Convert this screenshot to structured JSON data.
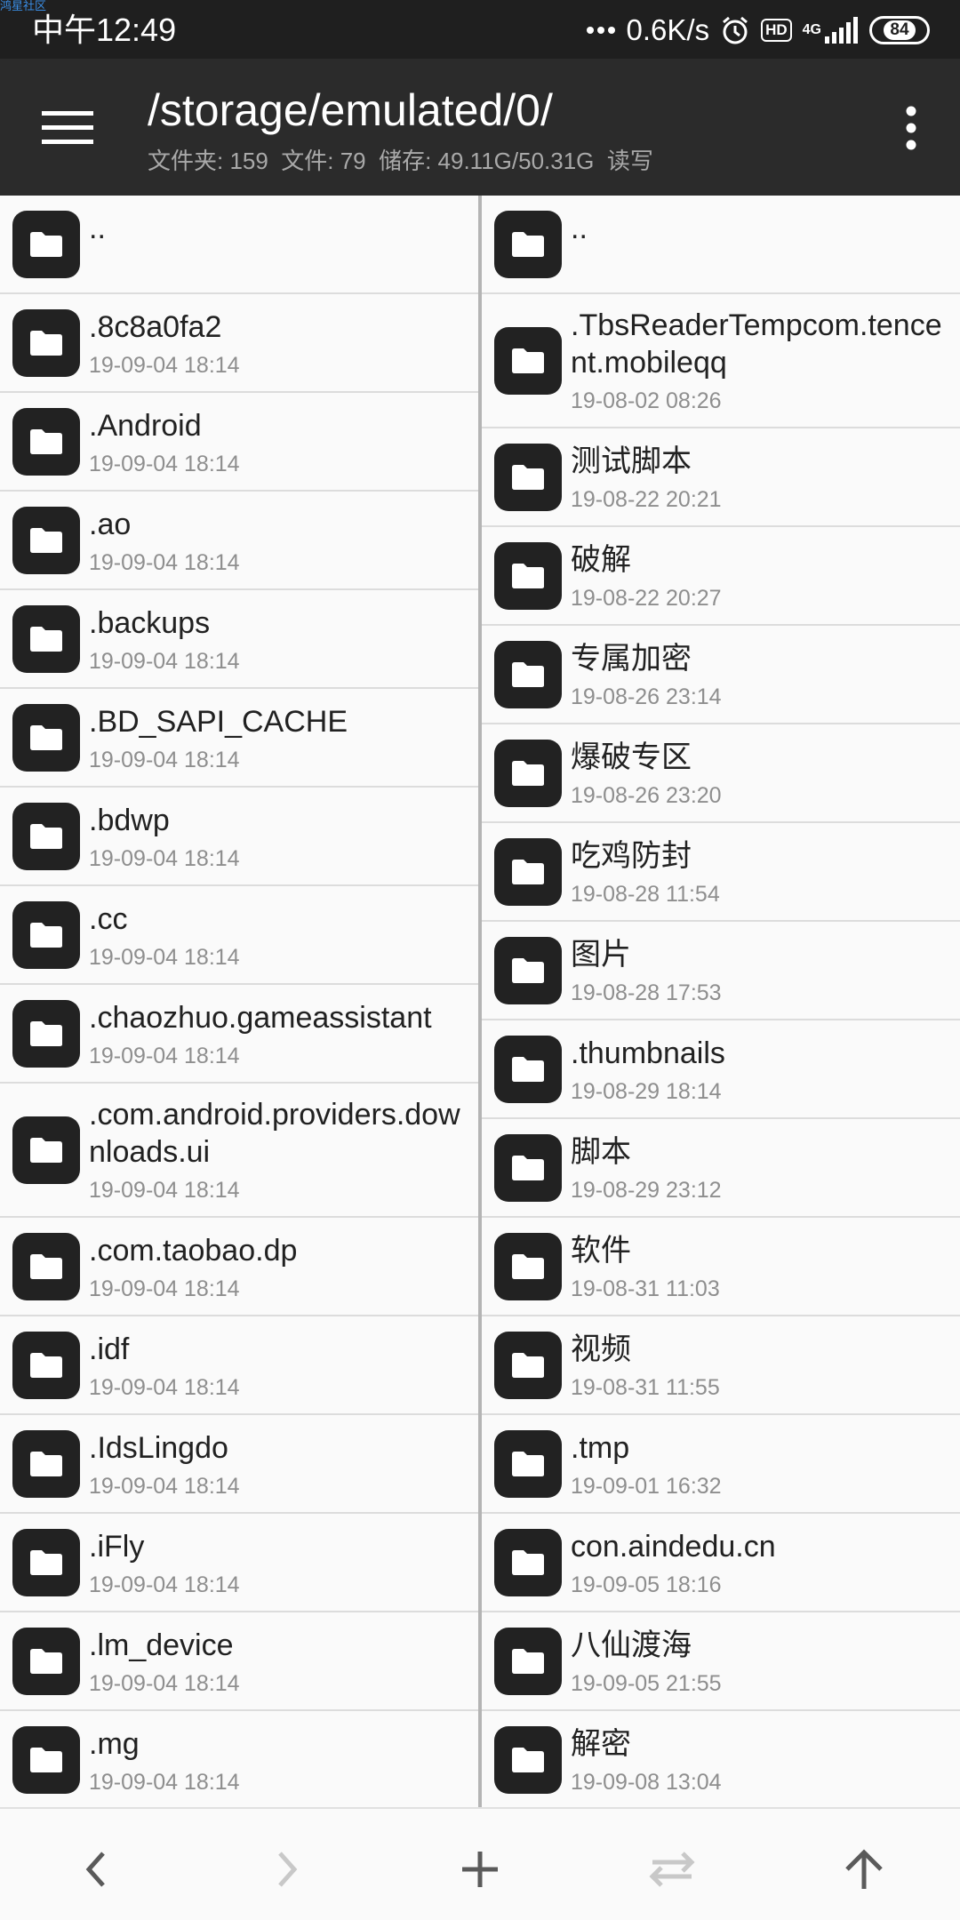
{
  "status_bar": {
    "watermark": "鸿星社区",
    "time": "中午12:49",
    "net_speed": "0.6K/s",
    "hd_badge": "HD",
    "network_type": "4G",
    "battery": "84",
    "icons": [
      "dots-icon",
      "alarm-icon",
      "hd-icon",
      "signal-icon",
      "battery-icon"
    ]
  },
  "app_bar": {
    "path": "/storage/emulated/0/",
    "subtitle": "文件夹: 159  文件: 79  储存: 49.11G/50.31G  读写",
    "icons": [
      "menu-icon",
      "more-vert-icon"
    ]
  },
  "left_pane": {
    "parent_label": "..",
    "items": [
      {
        "name": ".8c8a0fa2",
        "date": "19-09-04 18:14"
      },
      {
        "name": ".Android",
        "date": "19-09-04 18:14"
      },
      {
        "name": ".ao",
        "date": "19-09-04 18:14"
      },
      {
        "name": ".backups",
        "date": "19-09-04 18:14"
      },
      {
        "name": ".BD_SAPI_CACHE",
        "date": "19-09-04 18:14"
      },
      {
        "name": ".bdwp",
        "date": "19-09-04 18:14"
      },
      {
        "name": ".cc",
        "date": "19-09-04 18:14"
      },
      {
        "name": ".chaozhuo.gameassistant",
        "date": "19-09-04 18:14"
      },
      {
        "name": ".com.android.providers.downloads.ui",
        "date": "19-09-04 18:14"
      },
      {
        "name": ".com.taobao.dp",
        "date": "19-09-04 18:14"
      },
      {
        "name": ".idf",
        "date": "19-09-04 18:14"
      },
      {
        "name": ".IdsLingdo",
        "date": "19-09-04 18:14"
      },
      {
        "name": ".iFly",
        "date": "19-09-04 18:14"
      },
      {
        "name": ".lm_device",
        "date": "19-09-04 18:14"
      },
      {
        "name": ".mg",
        "date": "19-09-04 18:14"
      }
    ]
  },
  "right_pane": {
    "parent_label": "..",
    "items": [
      {
        "name": ".TbsReaderTempcom.tencent.mobileqq",
        "date": "19-08-02 08:26"
      },
      {
        "name": "测试脚本",
        "date": "19-08-22 20:21"
      },
      {
        "name": "破解",
        "date": "19-08-22 20:27"
      },
      {
        "name": "专属加密",
        "date": "19-08-26 23:14"
      },
      {
        "name": "爆破专区",
        "date": "19-08-26 23:20"
      },
      {
        "name": "吃鸡防封",
        "date": "19-08-28 11:54"
      },
      {
        "name": "图片",
        "date": "19-08-28 17:53"
      },
      {
        "name": ".thumbnails",
        "date": "19-08-29 18:14"
      },
      {
        "name": "脚本",
        "date": "19-08-29 23:12"
      },
      {
        "name": "软件",
        "date": "19-08-31 11:03"
      },
      {
        "name": "视频",
        "date": "19-08-31 11:55"
      },
      {
        "name": ".tmp",
        "date": "19-09-01 16:32"
      },
      {
        "name": "con.aindedu.cn",
        "date": "19-09-05 18:16"
      },
      {
        "name": "八仙渡海",
        "date": "19-09-05 21:55"
      },
      {
        "name": "解密",
        "date": "19-09-08 13:04"
      }
    ]
  },
  "bottom_bar": {
    "icons": [
      "back-arrow-icon",
      "forward-arrow-icon",
      "add-icon",
      "swap-icon",
      "up-arrow-icon"
    ],
    "forward_enabled": false,
    "swap_enabled": false
  },
  "colors": {
    "status_bar_bg": "#1f1f1f",
    "app_bar_bg": "#2b2b2b",
    "folder_icon_bg": "#222222",
    "date_text": "#8e8e8e",
    "disabled_icon": "#c8c8c8"
  }
}
